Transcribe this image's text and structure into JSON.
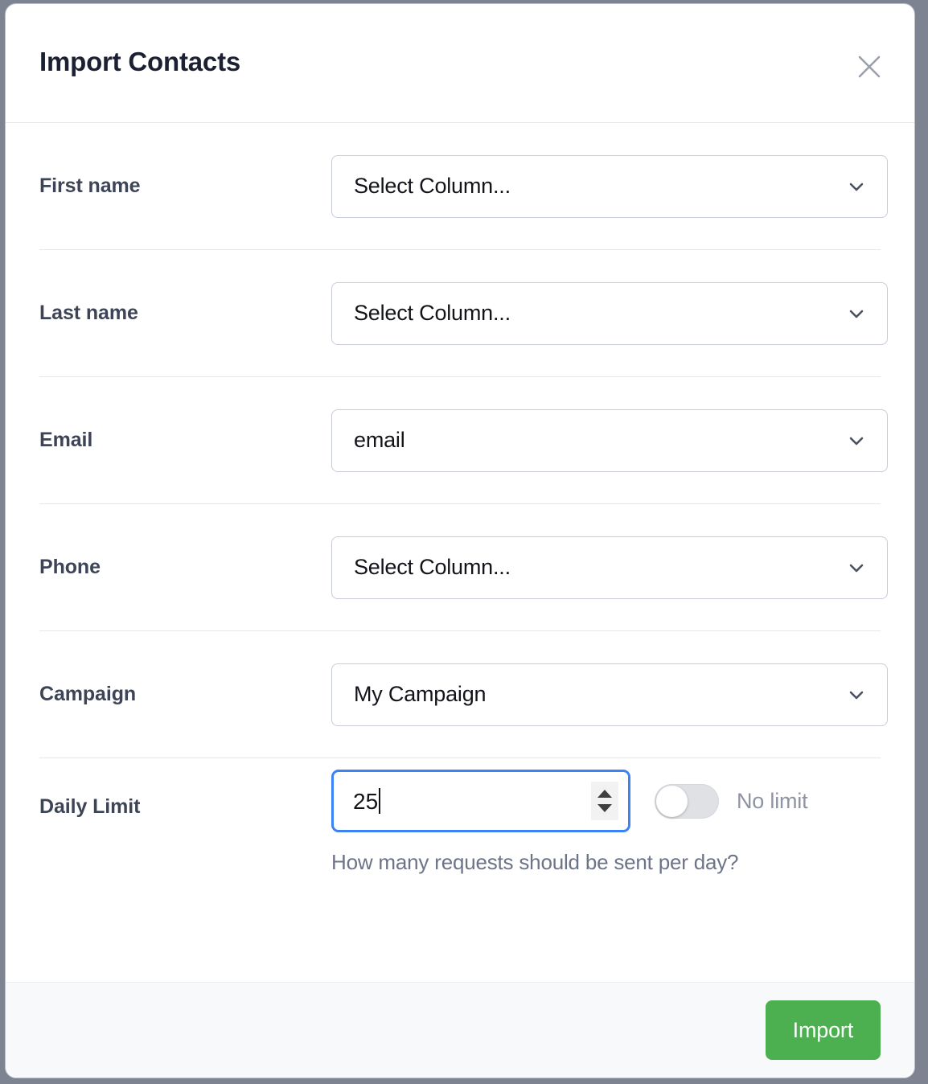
{
  "dialog": {
    "title": "Import Contacts",
    "close_icon": "close-icon"
  },
  "fields": [
    {
      "label": "First name",
      "value": "Select Column...",
      "icon": "chevron-down-icon"
    },
    {
      "label": "Last name",
      "value": "Select Column...",
      "icon": "chevron-down-icon"
    },
    {
      "label": "Email",
      "value": "email",
      "icon": "chevron-down-icon"
    },
    {
      "label": "Phone",
      "value": "Select Column...",
      "icon": "chevron-down-icon"
    },
    {
      "label": "Campaign",
      "value": "My Campaign",
      "icon": "chevron-down-icon"
    }
  ],
  "daily_limit": {
    "label": "Daily Limit",
    "value": "25",
    "toggle_label": "No limit",
    "toggle_state": "off",
    "help_text": "How many requests should be sent per day?",
    "spinner_up_icon": "spinner-up-icon",
    "spinner_down_icon": "spinner-down-icon"
  },
  "footer": {
    "import_label": "Import"
  },
  "colors": {
    "accent_green": "#4caf50",
    "focus_blue": "#3b82f6",
    "backdrop": "#7d8390",
    "label_text": "#3d4456",
    "muted_text": "#8e94a3"
  }
}
